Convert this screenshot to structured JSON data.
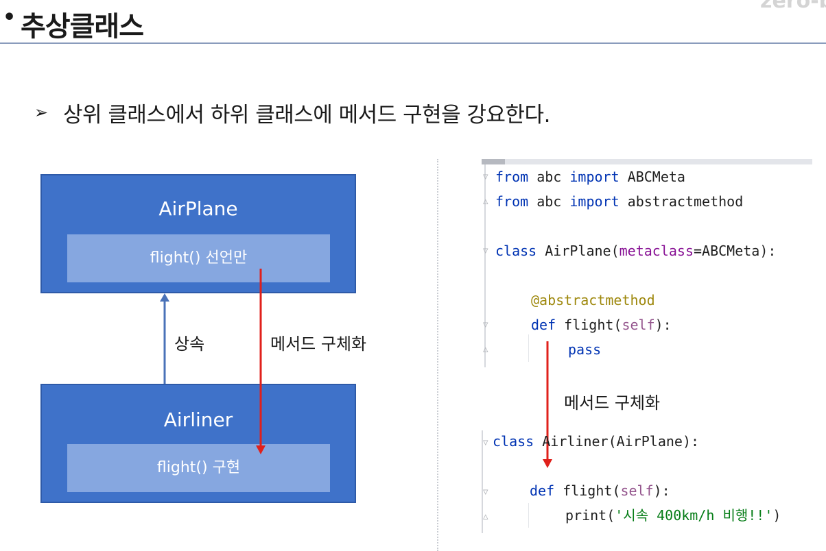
{
  "header": {
    "logo_text": "zero-b",
    "bullet": "•",
    "title": "추상클래스"
  },
  "subtitle": {
    "marker": "➢",
    "text": "상위 클래스에서 하위 클래스에 메서드 구현을 강요한다."
  },
  "diagram": {
    "parent": {
      "name": "AirPlane",
      "method": "flight() 선언만"
    },
    "child": {
      "name": "Airliner",
      "method": "flight() 구현"
    },
    "inherit_label": "상속",
    "implement_label": "메서드 구체화"
  },
  "code": {
    "line1": {
      "kw1": "from",
      "mod": " abc ",
      "kw2": "import",
      "name": " ABCMeta"
    },
    "line2": {
      "kw1": "from",
      "mod": " abc ",
      "kw2": "import",
      "name": " abstractmethod"
    },
    "line3": {
      "kw": "class",
      "cls": " AirPlane(",
      "param": "metaclass",
      "rest": "=ABCMeta):"
    },
    "line4": {
      "decorator": "@abstractmethod"
    },
    "line5": {
      "kw": "def",
      "fn": " flight(",
      "self": "self",
      "rest": "):"
    },
    "line6": {
      "kw": "pass"
    },
    "mid_label": "메서드 구체화",
    "line7": {
      "kw": "class",
      "rest": " Airliner(AirPlane):"
    },
    "line8": {
      "kw": "def",
      "fn": " flight(",
      "self": "self",
      "rest": "):"
    },
    "line9": {
      "fn": "print(",
      "str": "'시속 400km/h 비행!!'",
      "rest": ")"
    }
  },
  "colors": {
    "box_fill": "#3f72c9",
    "method_fill": "#86a7e0",
    "inherit_arrow": "#4a72b8",
    "implement_arrow": "#e0201b"
  }
}
